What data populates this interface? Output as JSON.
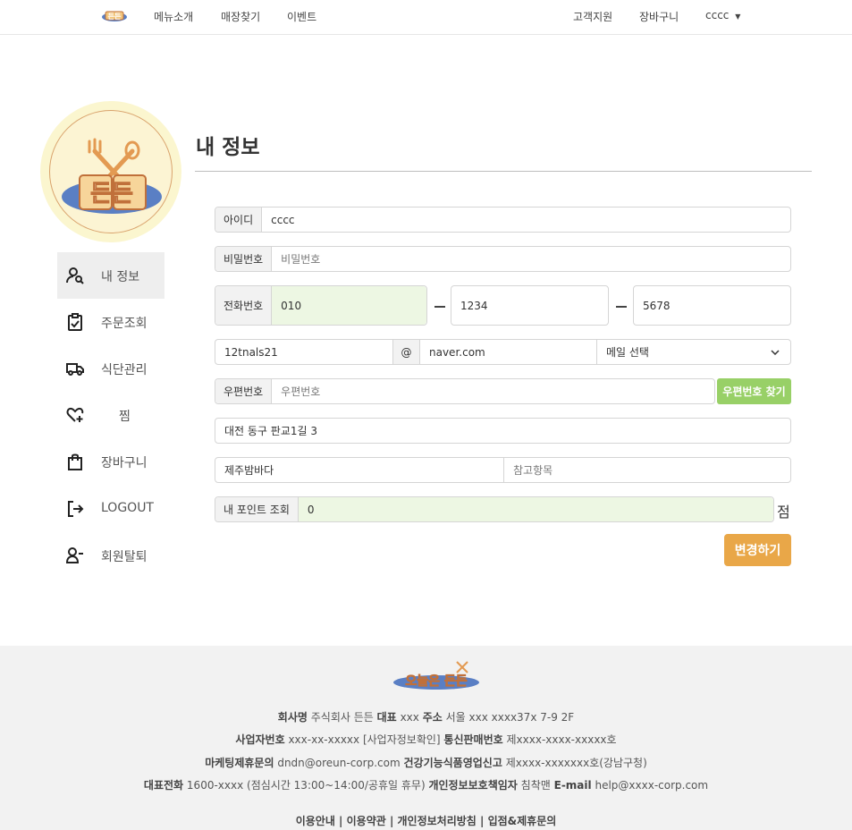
{
  "topnav": {
    "logo_text": "든든",
    "menu_intro": "메뉴소개",
    "store_find": "매장찾기",
    "event": "이벤트",
    "support": "고객지원",
    "cart": "장바구니",
    "user": "cccc"
  },
  "sidebar": {
    "logo_text": "든든",
    "items": [
      {
        "label": "내 정보",
        "icon": "user-search-icon"
      },
      {
        "label": "주문조회",
        "icon": "clipboard-check-icon"
      },
      {
        "label": "식단관리",
        "icon": "truck-icon"
      },
      {
        "label": "찜",
        "icon": "heart-plus-icon"
      },
      {
        "label": "장바구니",
        "icon": "shopping-bag-icon"
      },
      {
        "label": "LOGOUT",
        "icon": "logout-icon"
      },
      {
        "label": "회원탈퇴",
        "icon": "user-minus-icon"
      }
    ]
  },
  "page_title": "내 정보",
  "form": {
    "id_label": "아이디",
    "id_value": "cccc",
    "pw_label": "비밀번호",
    "pw_placeholder": "비밀번호",
    "phone_label": "전화번호",
    "phone1": "010",
    "phone2": "1234",
    "phone3": "5678",
    "email_id": "12tnals21",
    "email_at": "@",
    "email_domain": "naver.com",
    "email_select": "메일 선택",
    "zip_label": "우편번호",
    "zip_placeholder": "우편번호",
    "zip_button": "우편번호 찾기",
    "address": "대전 동구 판교1길 3",
    "address_detail": "제주밤바다",
    "address_ref_placeholder": "참고항목",
    "point_label": "내 포인트 조회",
    "point_value": "0",
    "point_unit": "점",
    "save_button": "변경하기"
  },
  "footer": {
    "logo_text": "오늘은 든든",
    "l1_k1": "회사명",
    "l1_v1": "주식회사 든든",
    "l1_k2": "대표",
    "l1_v2": "xxx",
    "l1_k3": "주소",
    "l1_v3": "서울 xxx xxxx37x 7-9 2F",
    "l2_k1": "사업자번호",
    "l2_v1": "xxx-xx-xxxxx [사업자정보확인]",
    "l2_k2": "통신판매번호",
    "l2_v2": "제xxxx-xxxx-xxxxx호",
    "l3_k1": "마케팅제휴문의",
    "l3_v1": "dndn@oreun-corp.com",
    "l3_k2": "건강기능식품영업신고",
    "l3_v2": "제xxxx-xxxxxxx호(강남구청)",
    "l4_k1": "대표전화",
    "l4_v1": "1600-xxxx (점심시간 13:00~14:00/공휴일 휴무)",
    "l4_k2": "개인정보보호책임자",
    "l4_v2": "침착맨",
    "l4_k3": "E-mail",
    "l4_v3": "help@xxxx-corp.com",
    "links": "이용안내 | 이용약관 | 개인정보처리방침 | 입점&제휴문의"
  },
  "colors": {
    "accent_orange": "#e9a748",
    "accent_green": "#98d067",
    "field_green": "#edf7e3",
    "logo_blue": "#5a7fc4"
  }
}
